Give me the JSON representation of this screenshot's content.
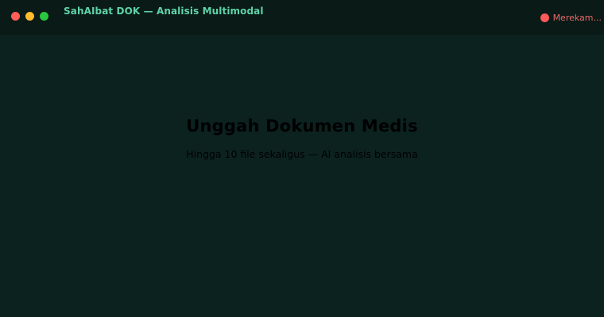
{
  "window": {
    "title": "SahAIbat DOK — Analisis Multimodal",
    "recording_label": "Merekam..."
  },
  "main": {
    "heading": "Unggah Dokumen Medis",
    "subtitle": "Hingga 10 file sekaligus — AI analisis bersama"
  },
  "colors": {
    "background": "#0c221f",
    "titlebar": "#0a1a17",
    "accent": "#5fd3a8",
    "recording": "#ff5a5a"
  }
}
